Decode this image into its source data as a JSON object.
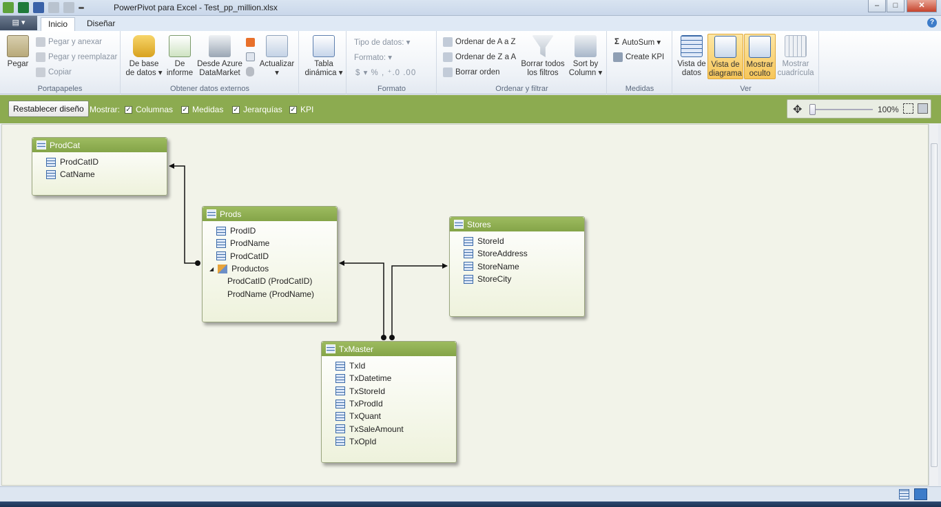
{
  "window": {
    "title": "PowerPivot para Excel - Test_pp_million.xlsx",
    "minimize": "–",
    "maximize": "□",
    "close": "✕"
  },
  "tabs": {
    "file": "▤ ▾",
    "inicio": "Inicio",
    "disenar": "Diseñar",
    "help": "?"
  },
  "ribbon": {
    "portapapeles": {
      "label": "Portapapeles",
      "pegar": "Pegar",
      "anexar": "Pegar y anexar",
      "reemplazar": "Pegar y reemplazar",
      "copiar": "Copiar"
    },
    "externos": {
      "label": "Obtener datos externos",
      "base1": "De base",
      "base2": "de datos ▾",
      "informe1": "De",
      "informe2": "informe",
      "azure1": "Desde Azure",
      "azure2": "DataMarket",
      "actualizar1": "Actualizar",
      "actualizar2": "▾"
    },
    "tabla": {
      "line1": "Tabla",
      "line2": "dinámica ▾"
    },
    "formato": {
      "label": "Formato",
      "tipo": "Tipo de datos: ▾",
      "formato": "Formato: ▾",
      "symbols": "$ ▾  %  ,  ⁺.0  .00"
    },
    "ordenar": {
      "label": "Ordenar y filtrar",
      "az": "Ordenar de A a Z",
      "za": "Ordenar de Z a A",
      "borrar_orden": "Borrar orden",
      "borrar1": "Borrar todos",
      "borrar2": "los filtros",
      "sort1": "Sort by",
      "sort2": "Column ▾"
    },
    "medidas": {
      "label": "Medidas",
      "autosum": "AutoSum ▾",
      "kpi": "Create KPI"
    },
    "ver": {
      "label": "Ver",
      "datos1": "Vista de",
      "datos2": "datos",
      "diag1": "Vista de",
      "diag2": "diagrama",
      "oculto1": "Mostrar",
      "oculto2": "oculto",
      "cuad1": "Mostrar",
      "cuad2": "cuadrícula"
    }
  },
  "diagram_toolbar": {
    "reset": "Restablecer diseño",
    "show": "Mostrar:",
    "columnas": "Columnas",
    "medidas": "Medidas",
    "jerarquias": "Jerarquías",
    "kpi": "KPI",
    "check": "✓",
    "zoom": "100%"
  },
  "tables": {
    "prodcat": {
      "name": "ProdCat",
      "cols": [
        "ProdCatID",
        "CatName"
      ]
    },
    "prods": {
      "name": "Prods",
      "cols": [
        "ProdID",
        "ProdName",
        "ProdCatID"
      ],
      "hierarchy": "Productos",
      "levels": [
        "ProdCatID  (ProdCatID)",
        "ProdName  (ProdName)"
      ]
    },
    "stores": {
      "name": "Stores",
      "cols": [
        "StoreId",
        "StoreAddress",
        "StoreName",
        "StoreCity"
      ]
    },
    "txmaster": {
      "name": "TxMaster",
      "cols": [
        "TxId",
        "TxDatetime",
        "TxStoreId",
        "TxProdId",
        "TxQuant",
        "TxSaleAmount",
        "TxOpId"
      ]
    }
  },
  "colors": {
    "green_bar": "#8cab50",
    "table_header": "#8fae52",
    "canvas": "#f2f3e9"
  }
}
